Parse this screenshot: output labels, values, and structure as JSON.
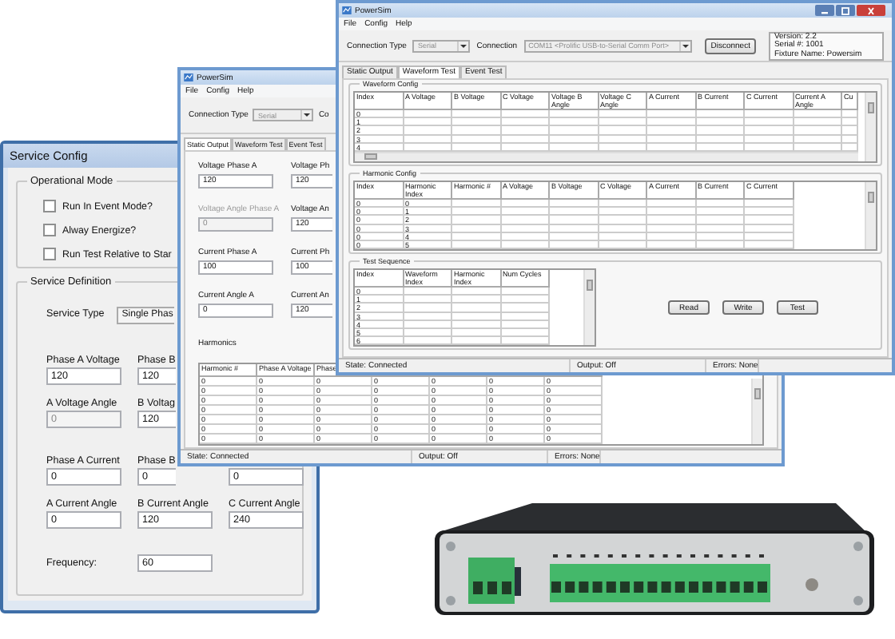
{
  "service_config": {
    "title": "Service Config",
    "operational_mode": {
      "label": "Operational Mode",
      "options": [
        {
          "label": "Run In Event Mode?",
          "checked": false
        },
        {
          "label": "Alway Energize?",
          "checked": false
        },
        {
          "label": "Run Test Relative to Star",
          "checked": false
        }
      ]
    },
    "service_definition": {
      "label": "Service Definition",
      "service_type_label": "Service Type",
      "service_type_value": "Single Phas",
      "field_rows": [
        {
          "labels": [
            "Phase A Voltage",
            "Phase B"
          ],
          "inputs": [
            {
              "value": "120",
              "disabled": false
            },
            {
              "value": "120",
              "disabled": false
            }
          ]
        },
        {
          "labels": [
            "A Voltage Angle",
            "B Voltag"
          ],
          "inputs": [
            {
              "value": "0",
              "disabled": true
            },
            {
              "value": "120",
              "disabled": false
            }
          ]
        },
        {
          "labels": [
            "Phase A Current",
            "Phase B"
          ],
          "inputs": [
            {
              "value": "0",
              "disabled": false
            },
            {
              "value": "0",
              "disabled": false
            },
            {
              "value": "0",
              "disabled": false
            }
          ]
        },
        {
          "labels": [
            "A Current Angle",
            "B Current Angle",
            "C Current Angle"
          ],
          "inputs": [
            {
              "value": "0",
              "disabled": false
            },
            {
              "value": "120",
              "disabled": false
            },
            {
              "value": "240",
              "disabled": false
            }
          ]
        }
      ],
      "frequency_label": "Frequency:",
      "frequency_value": "60"
    }
  },
  "static_output_window": {
    "title": "PowerSim",
    "menu": [
      "File",
      "Config",
      "Help"
    ],
    "connection_type_label": "Connection Type",
    "connection_type_value": "Serial",
    "connection_disabled": true,
    "connection_label": "Co",
    "tabs": [
      {
        "label": "Static Output",
        "selected": true
      },
      {
        "label": "Waveform Test",
        "selected": false
      },
      {
        "label": "Event Test",
        "selected": false
      }
    ],
    "fields": [
      {
        "label": "Voltage Phase A",
        "value": "120",
        "disabled": false
      },
      {
        "label": "Voltage Ph",
        "value": "120",
        "disabled": false
      },
      {
        "label": "Voltage Angle Phase A",
        "value": "0",
        "disabled": true
      },
      {
        "label": "Voltage An",
        "value": "120",
        "disabled": false
      },
      {
        "label": "Current Phase A",
        "value": "100",
        "disabled": false
      },
      {
        "label": "Current Ph",
        "value": "100",
        "disabled": false
      },
      {
        "label": "Current Angle A",
        "value": "0",
        "disabled": false
      },
      {
        "label": "Current An",
        "value": "120",
        "disabled": false
      }
    ],
    "harmonics": {
      "label": "Harmonics",
      "columns": [
        "Harmonic #",
        "Phase A Voltage",
        "Phase"
      ],
      "rows": [
        [
          "0",
          "0",
          "0",
          "0",
          "0",
          "0",
          "0"
        ],
        [
          "0",
          "0",
          "0",
          "0",
          "0",
          "0",
          "0"
        ],
        [
          "0",
          "0",
          "0",
          "0",
          "0",
          "0",
          "0"
        ],
        [
          "0",
          "0",
          "0",
          "0",
          "0",
          "0",
          "0"
        ],
        [
          "0",
          "0",
          "0",
          "0",
          "0",
          "0",
          "0"
        ],
        [
          "0",
          "0",
          "0",
          "0",
          "0",
          "0",
          "0"
        ],
        [
          "0",
          "0",
          "0",
          "0",
          "0",
          "0",
          "0"
        ]
      ]
    },
    "status_bar": [
      "State: Connected",
      "Output: Off",
      "Errors: None"
    ]
  },
  "waveform_test_window": {
    "title": "PowerSim",
    "menu": [
      "File",
      "Config",
      "Help"
    ],
    "connection_type_label": "Connection Type",
    "connection_type_value": "Serial",
    "connection_disabled": true,
    "connection_label": "Connection",
    "connection_value": "COM11 <Prolific USB-to-Serial Comm Port>",
    "disconnect_button": "Disconnect",
    "info": [
      "Version: 2.2",
      "Serial #: 1001",
      "Fixture Name: Powersim"
    ],
    "tabs": [
      {
        "label": "Static Output",
        "selected": false
      },
      {
        "label": "Waveform Test",
        "selected": true
      },
      {
        "label": "Event Test",
        "selected": false
      }
    ],
    "waveform_config": {
      "label": "Waveform Config",
      "columns": [
        "Index",
        "A Voltage",
        "B Voltage",
        "C Voltage",
        "Voltage B Angle",
        "Voltage C Angle",
        "A Current",
        "B Current",
        "C Current",
        "Current A Angle",
        "Cu"
      ],
      "rows": [
        [
          "0"
        ],
        [
          "1"
        ],
        [
          "2"
        ],
        [
          "3"
        ],
        [
          "4"
        ]
      ]
    },
    "harmonic_config": {
      "label": "Harmonic Config",
      "columns": [
        "Index",
        "Harmonic Index",
        "Harmonic #",
        "A Voltage",
        "B Voltage",
        "C Voltage",
        "A Current",
        "B Current",
        "C Current"
      ],
      "rows": [
        [
          "0",
          "0"
        ],
        [
          "0",
          "1"
        ],
        [
          "0",
          "2"
        ],
        [
          "0",
          "3"
        ],
        [
          "0",
          "4"
        ],
        [
          "0",
          "5"
        ]
      ]
    },
    "test_sequence": {
      "label": "Test Sequence",
      "columns": [
        "Index",
        "Waveform Index",
        "Harmonic Index",
        "Num Cycles"
      ],
      "rows": [
        [
          "0"
        ],
        [
          "1"
        ],
        [
          "2"
        ],
        [
          "3"
        ],
        [
          "4"
        ],
        [
          "5"
        ],
        [
          "6"
        ]
      ]
    },
    "buttons": [
      "Read",
      "Write",
      "Test"
    ],
    "status_bar": [
      "State: Connected",
      "Output: Off",
      "Errors: None"
    ]
  }
}
